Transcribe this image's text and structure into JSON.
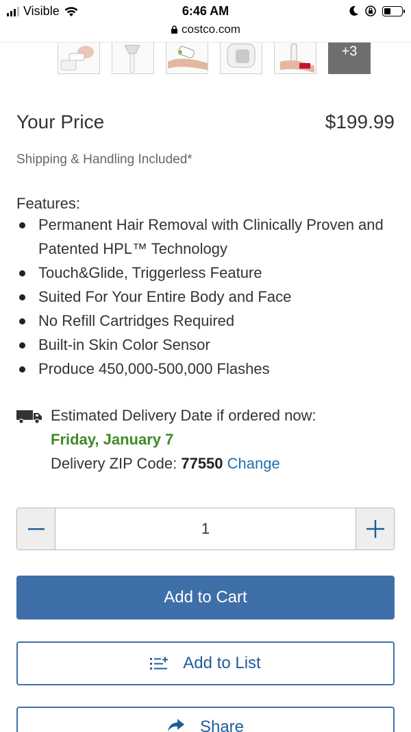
{
  "status_bar": {
    "carrier": "Visible",
    "time": "6:46 AM",
    "url": "costco.com"
  },
  "gallery": {
    "more_label": "+3"
  },
  "price": {
    "label": "Your Price",
    "value": "$199.99",
    "shipping_note": "Shipping & Handling Included*"
  },
  "features": {
    "title": "Features:",
    "items": [
      "Permanent Hair Removal with Clinically Proven and Patented HPL™ Technology",
      "Touch&Glide, Triggerless Feature",
      "Suited For Your Entire Body and Face",
      "No Refill Cartridges Required",
      "Built-in Skin Color Sensor",
      "Produce 450,000-500,000 Flashes"
    ]
  },
  "delivery": {
    "label": "Estimated Delivery Date if ordered now:",
    "date": "Friday, January 7",
    "zip_label": "Delivery ZIP Code:",
    "zip": "77550",
    "change_link": "Change"
  },
  "quantity": {
    "value": "1"
  },
  "actions": {
    "add_to_cart": "Add to Cart",
    "add_to_list": "Add to List",
    "share": "Share"
  },
  "colors": {
    "primary_button": "#3f6fa8",
    "link": "#1d6fb3",
    "delivery_date": "#3d8b25"
  }
}
